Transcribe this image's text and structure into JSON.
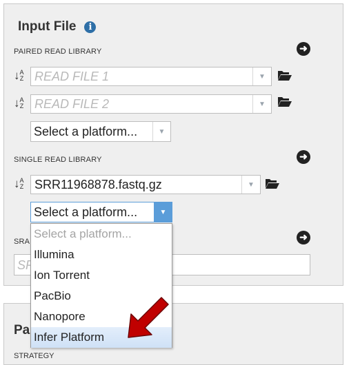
{
  "section": {
    "title": "Input File",
    "info_icon": "info-icon"
  },
  "paired": {
    "label": "PAIRED READ LIBRARY",
    "read1_placeholder": "READ FILE 1",
    "read2_placeholder": "READ FILE 2",
    "platform": "Select a platform..."
  },
  "single": {
    "label": "SINGLE READ LIBRARY",
    "file_value": "SRR11968878.fastq.gz",
    "platform": "Select a platform..."
  },
  "sra": {
    "label_visible": "SRA",
    "placeholder_visible": "SR"
  },
  "dropdown": {
    "options": [
      "Select a platform...",
      "Illumina",
      "Ion Torrent",
      "PacBio",
      "Nanopore",
      "Infer Platform"
    ],
    "highlighted": "Infer Platform"
  },
  "params": {
    "title_visible": "Pa",
    "strategy_visible": "STRATEGY"
  },
  "colors": {
    "accent": "#5b9dd9",
    "info": "#2e6fa7",
    "arrow": "#c00000"
  }
}
